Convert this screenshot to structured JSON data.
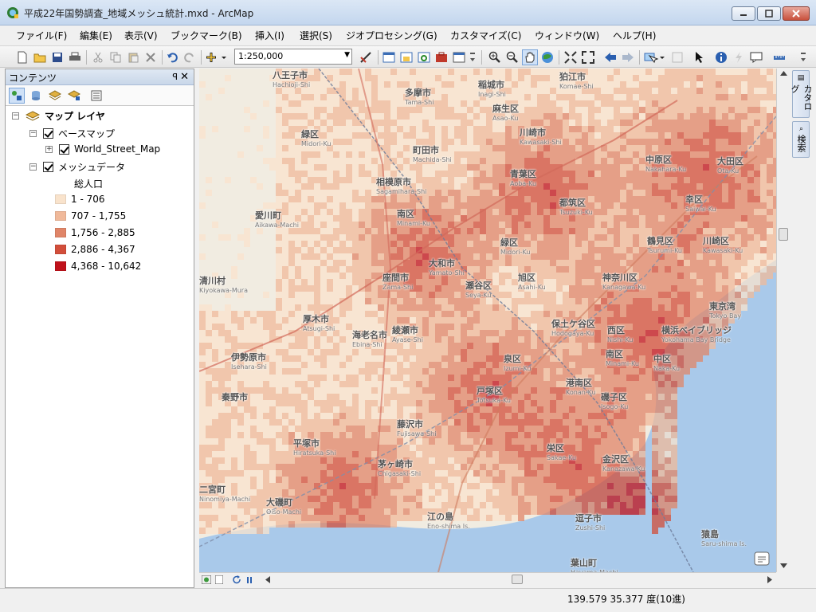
{
  "window": {
    "title": "平成22年国勢調査_地域メッシュ統計.mxd - ArcMap",
    "app_icon": "arcmap-globe-icon"
  },
  "menu": [
    "ファイル(F)",
    "編集(E)",
    "表示(V)",
    "ブックマーク(B)",
    "挿入(I)",
    "選択(S)",
    "ジオプロセシング(G)",
    "カスタマイズ(C)",
    "ウィンドウ(W)",
    "ヘルプ(H)"
  ],
  "toolbar": {
    "scale": "1:250,000"
  },
  "toc": {
    "title": "コンテンツ",
    "root": "マップ レイヤ",
    "basemap_group": "ベースマップ",
    "basemap_layer": "World_Street_Map",
    "mesh_layer": "メッシュデータ",
    "field": "総人口",
    "legend": [
      {
        "label": "1 - 706",
        "color": "#f9e3cc"
      },
      {
        "label": "707 - 1,755",
        "color": "#f0b99a"
      },
      {
        "label": "1,756 - 2,885",
        "color": "#e08568"
      },
      {
        "label": "2,886 - 4,367",
        "color": "#d24e3a"
      },
      {
        "label": "4,368 - 10,642",
        "color": "#c0121b"
      }
    ]
  },
  "dock": {
    "catalog": "カタログ",
    "search": "検索"
  },
  "map": {
    "places": [
      {
        "ja": "八王子市",
        "en": "Hachioji-Shi"
      },
      {
        "ja": "多摩市",
        "en": "Tama-Shi"
      },
      {
        "ja": "稲城市",
        "en": "Inagi-Shi"
      },
      {
        "ja": "狛江市",
        "en": "Komae-Shi"
      },
      {
        "ja": "麻生区",
        "en": "Asao-Ku"
      },
      {
        "ja": "町田市",
        "en": "Machida-Shi"
      },
      {
        "ja": "川崎市",
        "en": "Kawasaki-Shi"
      },
      {
        "ja": "緑区",
        "en": "Midori-Ku"
      },
      {
        "ja": "相模原市",
        "en": "Sagamihara-Shi"
      },
      {
        "ja": "青葉区",
        "en": "Aoba-Ku"
      },
      {
        "ja": "中原区",
        "en": "Nakahara-Ku"
      },
      {
        "ja": "大田区",
        "en": "Ota-Ku"
      },
      {
        "ja": "愛川町",
        "en": "Aikawa-Machi"
      },
      {
        "ja": "南区",
        "en": "Minami-Ku"
      },
      {
        "ja": "都筑区",
        "en": "Tsuzuki-Ku"
      },
      {
        "ja": "幸区",
        "en": "Saiwai-Ku"
      },
      {
        "ja": "大和市",
        "en": "Yamato-Shi"
      },
      {
        "ja": "緑区",
        "en": "Midori-Ku"
      },
      {
        "ja": "鶴見区",
        "en": "Tsurumi-Ku"
      },
      {
        "ja": "川崎区",
        "en": "Kawasaki-Ku"
      },
      {
        "ja": "清川村",
        "en": "Kiyokawa-Mura"
      },
      {
        "ja": "座間市",
        "en": "Zama-Shi"
      },
      {
        "ja": "瀬谷区",
        "en": "Seya-Ku"
      },
      {
        "ja": "旭区",
        "en": "Asahi-Ku"
      },
      {
        "ja": "神奈川区",
        "en": "Kanagawa-Ku"
      },
      {
        "ja": "厚木市",
        "en": "Atsugi-Shi"
      },
      {
        "ja": "海老名市",
        "en": "Ebina-Shi"
      },
      {
        "ja": "綾瀬市",
        "en": "Ayase-Shi"
      },
      {
        "ja": "保土ケ谷区",
        "en": "Hodogaya-Ku"
      },
      {
        "ja": "西区",
        "en": "Nishi-Ku"
      },
      {
        "ja": "横浜ベイブリッジ",
        "en": "Yokohama Bay Bridge"
      },
      {
        "ja": "伊勢原市",
        "en": "Isehara-Shi"
      },
      {
        "ja": "泉区",
        "en": "Izumi-Ku"
      },
      {
        "ja": "南区",
        "en": "Minami-Ku"
      },
      {
        "ja": "中区",
        "en": "Naka-Ku"
      },
      {
        "ja": "港南区",
        "en": "Konan-Ku"
      },
      {
        "ja": "秦野市",
        "en": ""
      },
      {
        "ja": "戸塚区",
        "en": "Totsuka-Ku"
      },
      {
        "ja": "磯子区",
        "en": "Isogo-Ku"
      },
      {
        "ja": "藤沢市",
        "en": "Fujisawa-Shi"
      },
      {
        "ja": "平塚市",
        "en": "Hiratsuka-Shi"
      },
      {
        "ja": "栄区",
        "en": "Sakae-Ku"
      },
      {
        "ja": "茅ヶ崎市",
        "en": "Chigasaki-Shi"
      },
      {
        "ja": "金沢区",
        "en": "Kanazawa-Ku"
      },
      {
        "ja": "二宮町",
        "en": "Ninomiya-Machi"
      },
      {
        "ja": "江の島",
        "en": "Eno-shima Is."
      },
      {
        "ja": "逗子市",
        "en": "Zushi-Shi"
      },
      {
        "ja": "猿島",
        "en": "Saru-shima Is."
      },
      {
        "ja": "大磯町",
        "en": "Oiso-Machi"
      },
      {
        "ja": "葉山町",
        "en": "Hayama-Machi"
      },
      {
        "ja": "東京湾",
        "en": "Tokyo Bay"
      }
    ]
  },
  "status": {
    "coords": "139.579  35.377 度(10進)"
  }
}
